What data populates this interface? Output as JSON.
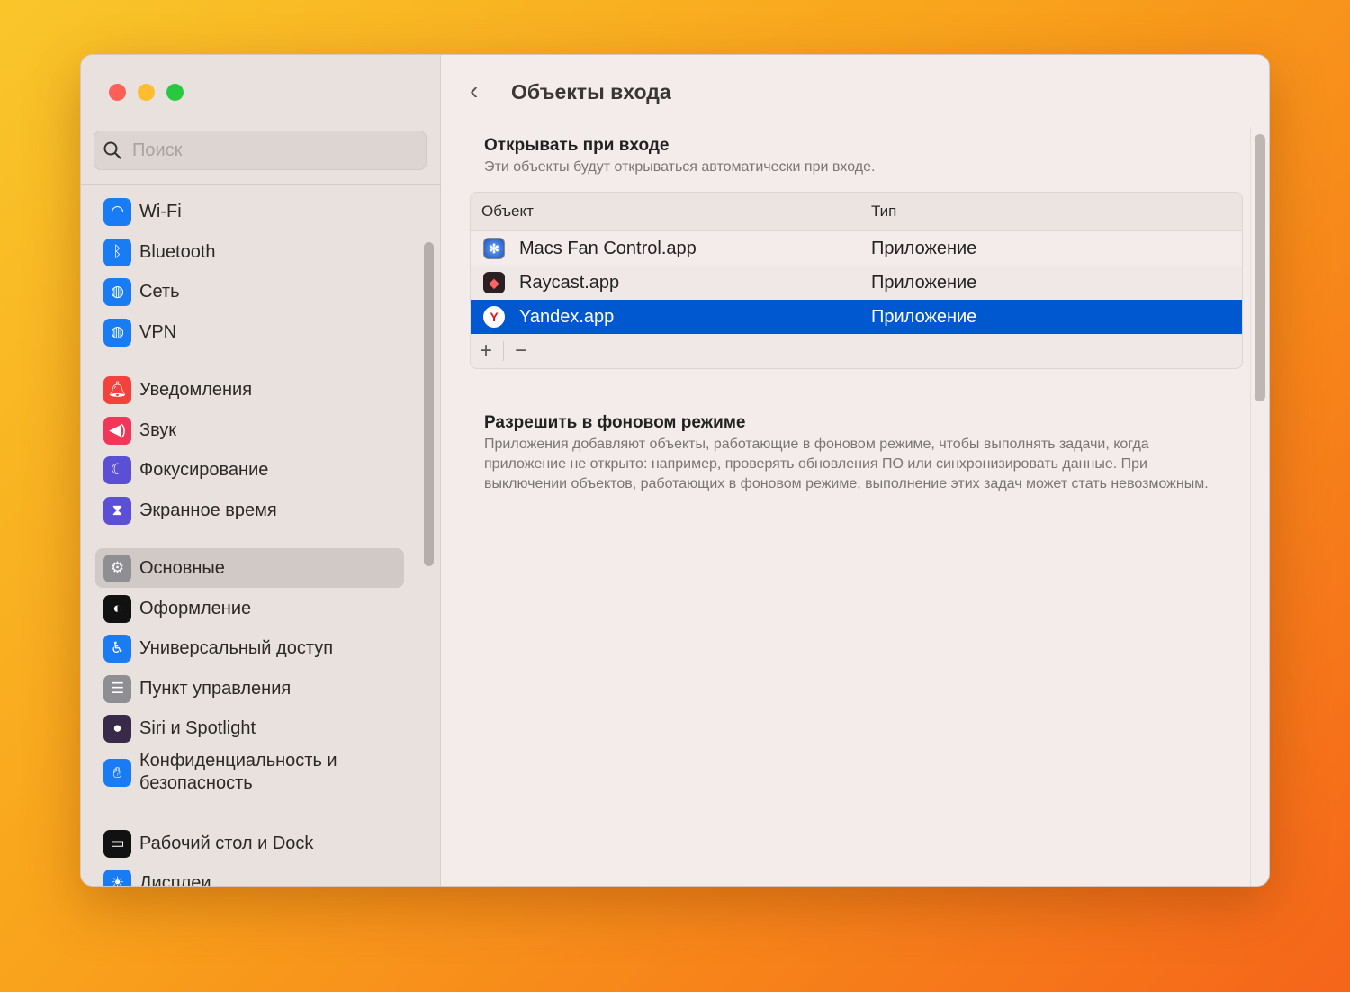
{
  "window": {
    "traffic_lights": {
      "close": "#fe5f57",
      "minimize": "#febc2e",
      "zoom": "#28c840"
    }
  },
  "sidebar": {
    "search_placeholder": "Поиск",
    "items": [
      {
        "label": "Wi-Fi",
        "icon": "wifi-icon",
        "color": "#1a7cf5"
      },
      {
        "label": "Bluetooth",
        "icon": "bluetooth-icon",
        "color": "#1a7cf5"
      },
      {
        "label": "Сеть",
        "icon": "globe-icon",
        "color": "#1a7cf5"
      },
      {
        "label": "VPN",
        "icon": "vpn-icon",
        "color": "#1a7cf5"
      },
      {
        "label": "Уведомления",
        "icon": "bell-icon",
        "color": "#f2423b"
      },
      {
        "label": "Звук",
        "icon": "speaker-icon",
        "color": "#f2365a"
      },
      {
        "label": "Фокусирование",
        "icon": "moon-icon",
        "color": "#5b4fd6"
      },
      {
        "label": "Экранное время",
        "icon": "hourglass-icon",
        "color": "#5b4fd6"
      },
      {
        "label": "Основные",
        "icon": "gear-icon",
        "color": "#8e8e93",
        "selected": true
      },
      {
        "label": "Оформление",
        "icon": "appearance-icon",
        "color": "#111111"
      },
      {
        "label": "Универсальный доступ",
        "icon": "accessibility-icon",
        "color": "#1a7cf5"
      },
      {
        "label": "Пункт управления",
        "icon": "toggles-icon",
        "color": "#8e8e93"
      },
      {
        "label": "Siri и Spotlight",
        "icon": "siri-icon",
        "color": "#3a2a4a"
      },
      {
        "label": "Конфиденциальность и безопасность",
        "icon": "hand-icon",
        "color": "#1a7cf5"
      },
      {
        "label": "Рабочий стол и Dock",
        "icon": "dock-icon",
        "color": "#111111"
      },
      {
        "label": "Дисплеи",
        "icon": "sun-icon",
        "color": "#1a7cf5"
      }
    ]
  },
  "main": {
    "title": "Объекты входа",
    "open_at_login": {
      "title": "Открывать при входе",
      "subtitle": "Эти объекты будут открываться автоматически при входе.",
      "columns": [
        "Объект",
        "Тип"
      ],
      "rows": [
        {
          "name": "Macs Fan Control.app",
          "type": "Приложение"
        },
        {
          "name": "Raycast.app",
          "type": "Приложение"
        },
        {
          "name": "Yandex.app",
          "type": "Приложение",
          "selected": true
        }
      ],
      "add_label": "+",
      "remove_label": "−"
    },
    "background": {
      "title": "Разрешить в фоновом режиме",
      "description": "Приложения добавляют объекты, работающие в фоновом режиме, чтобы выполнять задачи, когда приложение не открыто: например, проверять обновления ПО или синхронизировать данные. При выключении объектов, работающих в фоновом режиме, выполнение этих задач может стать невозможным."
    }
  }
}
